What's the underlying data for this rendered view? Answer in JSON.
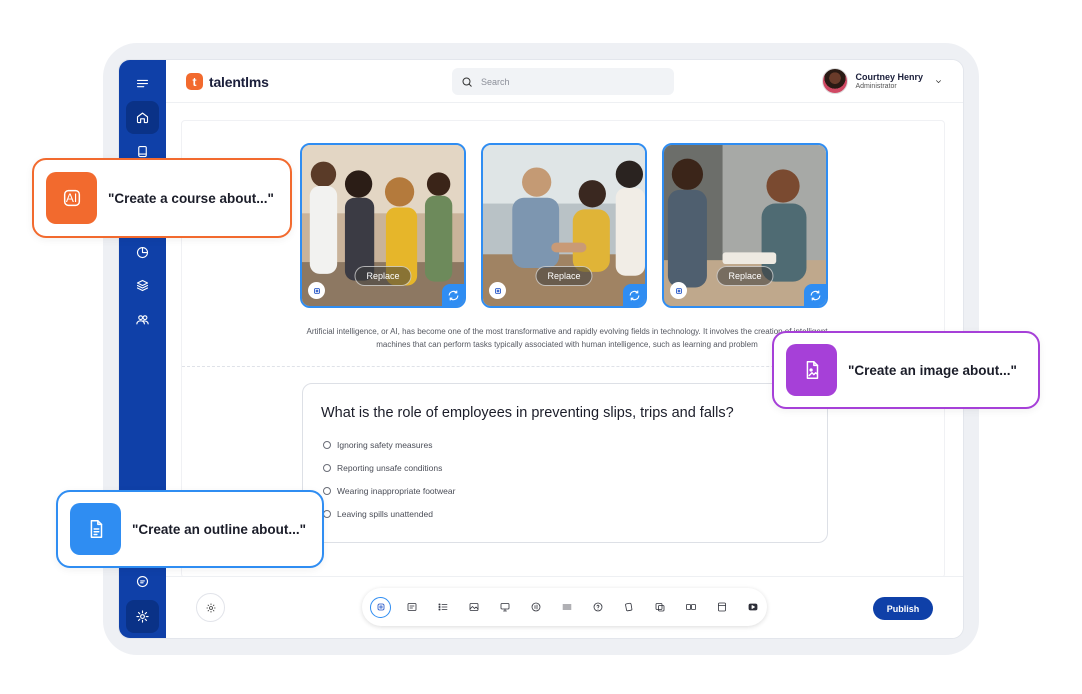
{
  "app": {
    "logo_letter": "t",
    "logo_text": "talentlms"
  },
  "search": {
    "placeholder": "Search"
  },
  "user": {
    "name": "Courtney Henry",
    "role": "Administrator"
  },
  "sidebar": {
    "items": [
      {
        "icon": "menu-icon"
      },
      {
        "icon": "home-icon",
        "active": true
      },
      {
        "icon": "book-icon"
      },
      {
        "icon": "pie-chart-icon"
      },
      {
        "icon": "layers-icon"
      },
      {
        "icon": "users-icon"
      },
      {
        "icon": "chat-icon"
      },
      {
        "icon": "settings-icon"
      }
    ]
  },
  "images": [
    {
      "replace_label": "Replace"
    },
    {
      "replace_label": "Replace"
    },
    {
      "replace_label": "Replace"
    }
  ],
  "content": {
    "paragraph": "Artificial intelligence, or AI, has become one of the most transformative and rapidly evolving fields in technology. It involves the creation of intelligent machines that can perform tasks typically associated with human intelligence, such as learning and problem"
  },
  "quiz": {
    "question": "What is the role of employees in preventing slips, trips and falls?",
    "options": [
      "Ignoring safety measures",
      "Reporting unsafe conditions",
      "Wearing inappropriate footwear",
      "Leaving spills unattended"
    ]
  },
  "toolbar": {
    "tools": [
      "ai-icon",
      "text-icon",
      "list-icon",
      "image-icon",
      "screen-icon",
      "audio-icon",
      "divider-icon",
      "question-icon",
      "flashcard-icon",
      "gallery-icon",
      "compare-icon",
      "card-icon",
      "video-icon"
    ],
    "publish_label": "Publish"
  },
  "callouts": {
    "course": {
      "badge": "AI",
      "text": "\"Create a course about...\""
    },
    "image": {
      "text": "\"Create an image about...\""
    },
    "outline": {
      "text": "\"Create an outline about...\""
    }
  },
  "colors": {
    "sidebar": "#0f40a8",
    "accent_blue": "#2f8df2",
    "ai_orange": "#f26a2e",
    "image_purple": "#a640d8",
    "publish": "#0f40a8"
  }
}
